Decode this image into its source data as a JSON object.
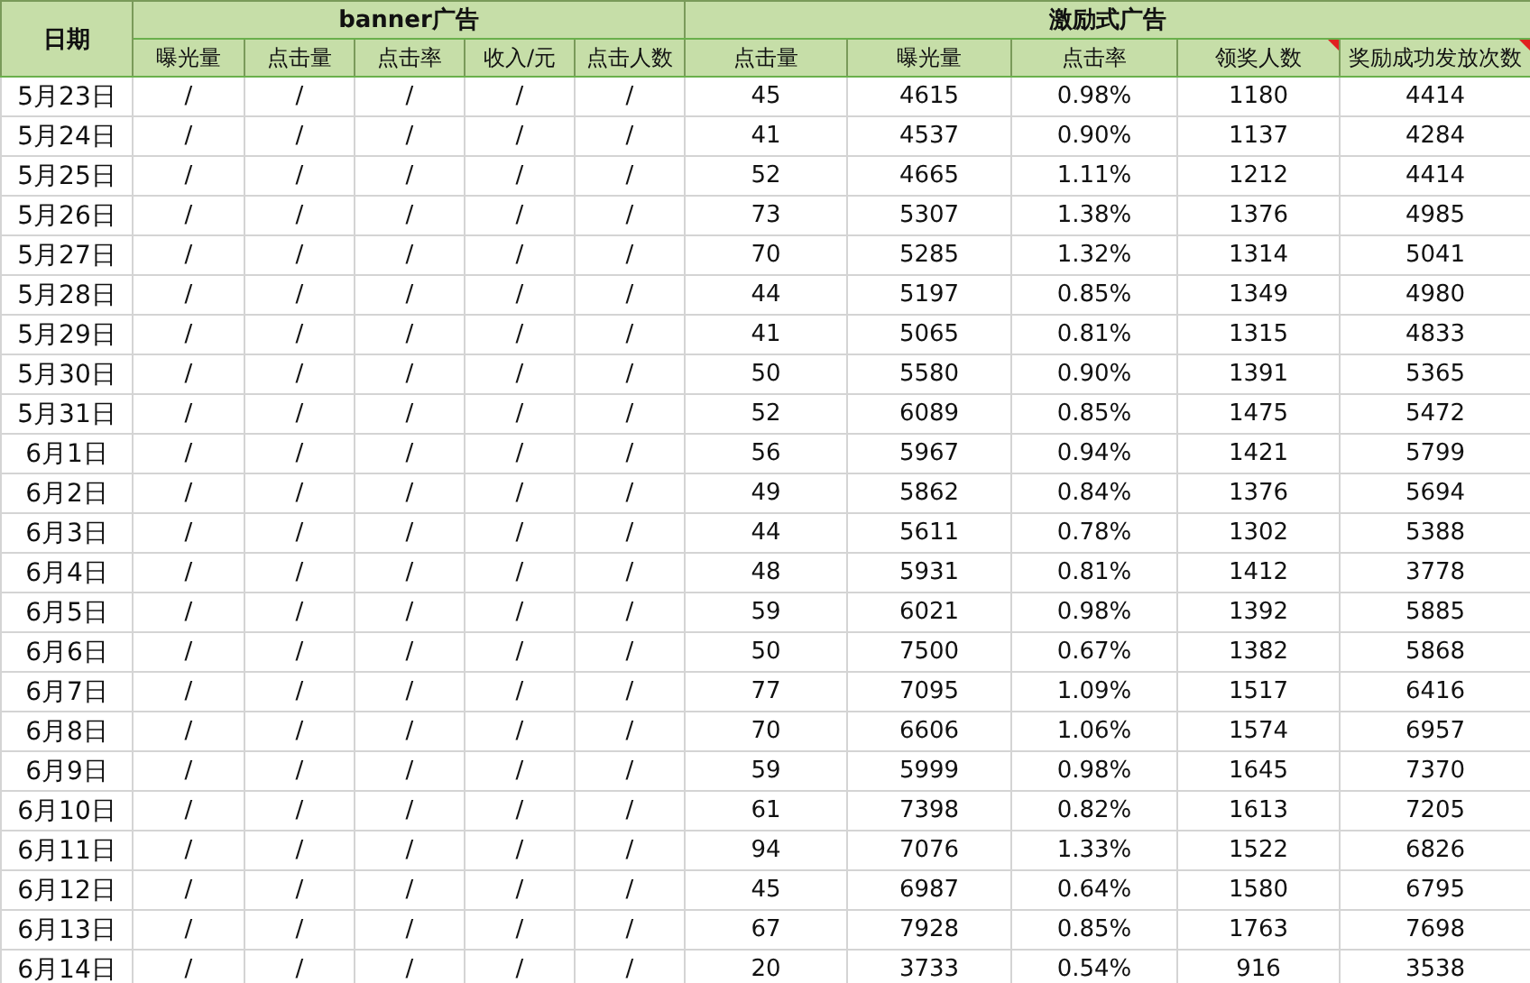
{
  "table": {
    "date_header": "日期",
    "groups": [
      {
        "title": "banner广告",
        "columns": [
          {
            "label": "曝光量",
            "has_comment": false
          },
          {
            "label": "点击量",
            "has_comment": false
          },
          {
            "label": "点击率",
            "has_comment": false
          },
          {
            "label": "收入/元",
            "has_comment": false
          },
          {
            "label": "点击人数",
            "has_comment": false
          }
        ]
      },
      {
        "title": "激励式广告",
        "columns": [
          {
            "label": "点击量",
            "has_comment": false
          },
          {
            "label": "曝光量",
            "has_comment": false
          },
          {
            "label": "点击率",
            "has_comment": false
          },
          {
            "label": "领奖人数",
            "has_comment": true
          },
          {
            "label": "奖励成功发放次数",
            "has_comment": true
          }
        ]
      }
    ],
    "rows": [
      {
        "date": "5月23日",
        "cells": [
          "/",
          "/",
          "/",
          "/",
          "/",
          "45",
          "4615",
          "0.98%",
          "1180",
          "4414"
        ]
      },
      {
        "date": "5月24日",
        "cells": [
          "/",
          "/",
          "/",
          "/",
          "/",
          "41",
          "4537",
          "0.90%",
          "1137",
          "4284"
        ]
      },
      {
        "date": "5月25日",
        "cells": [
          "/",
          "/",
          "/",
          "/",
          "/",
          "52",
          "4665",
          "1.11%",
          "1212",
          "4414"
        ]
      },
      {
        "date": "5月26日",
        "cells": [
          "/",
          "/",
          "/",
          "/",
          "/",
          "73",
          "5307",
          "1.38%",
          "1376",
          "4985"
        ]
      },
      {
        "date": "5月27日",
        "cells": [
          "/",
          "/",
          "/",
          "/",
          "/",
          "70",
          "5285",
          "1.32%",
          "1314",
          "5041"
        ]
      },
      {
        "date": "5月28日",
        "cells": [
          "/",
          "/",
          "/",
          "/",
          "/",
          "44",
          "5197",
          "0.85%",
          "1349",
          "4980"
        ]
      },
      {
        "date": "5月29日",
        "cells": [
          "/",
          "/",
          "/",
          "/",
          "/",
          "41",
          "5065",
          "0.81%",
          "1315",
          "4833"
        ]
      },
      {
        "date": "5月30日",
        "cells": [
          "/",
          "/",
          "/",
          "/",
          "/",
          "50",
          "5580",
          "0.90%",
          "1391",
          "5365"
        ]
      },
      {
        "date": "5月31日",
        "cells": [
          "/",
          "/",
          "/",
          "/",
          "/",
          "52",
          "6089",
          "0.85%",
          "1475",
          "5472"
        ]
      },
      {
        "date": "6月1日",
        "cells": [
          "/",
          "/",
          "/",
          "/",
          "/",
          "56",
          "5967",
          "0.94%",
          "1421",
          "5799"
        ]
      },
      {
        "date": "6月2日",
        "cells": [
          "/",
          "/",
          "/",
          "/",
          "/",
          "49",
          "5862",
          "0.84%",
          "1376",
          "5694"
        ]
      },
      {
        "date": "6月3日",
        "cells": [
          "/",
          "/",
          "/",
          "/",
          "/",
          "44",
          "5611",
          "0.78%",
          "1302",
          "5388"
        ]
      },
      {
        "date": "6月4日",
        "cells": [
          "/",
          "/",
          "/",
          "/",
          "/",
          "48",
          "5931",
          "0.81%",
          "1412",
          "3778"
        ]
      },
      {
        "date": "6月5日",
        "cells": [
          "/",
          "/",
          "/",
          "/",
          "/",
          "59",
          "6021",
          "0.98%",
          "1392",
          "5885"
        ]
      },
      {
        "date": "6月6日",
        "cells": [
          "/",
          "/",
          "/",
          "/",
          "/",
          "50",
          "7500",
          "0.67%",
          "1382",
          "5868"
        ]
      },
      {
        "date": "6月7日",
        "cells": [
          "/",
          "/",
          "/",
          "/",
          "/",
          "77",
          "7095",
          "1.09%",
          "1517",
          "6416"
        ]
      },
      {
        "date": "6月8日",
        "cells": [
          "/",
          "/",
          "/",
          "/",
          "/",
          "70",
          "6606",
          "1.06%",
          "1574",
          "6957"
        ]
      },
      {
        "date": "6月9日",
        "cells": [
          "/",
          "/",
          "/",
          "/",
          "/",
          "59",
          "5999",
          "0.98%",
          "1645",
          "7370"
        ]
      },
      {
        "date": "6月10日",
        "cells": [
          "/",
          "/",
          "/",
          "/",
          "/",
          "61",
          "7398",
          "0.82%",
          "1613",
          "7205"
        ]
      },
      {
        "date": "6月11日",
        "cells": [
          "/",
          "/",
          "/",
          "/",
          "/",
          "94",
          "7076",
          "1.33%",
          "1522",
          "6826"
        ]
      },
      {
        "date": "6月12日",
        "cells": [
          "/",
          "/",
          "/",
          "/",
          "/",
          "45",
          "6987",
          "0.64%",
          "1580",
          "6795"
        ]
      },
      {
        "date": "6月13日",
        "cells": [
          "/",
          "/",
          "/",
          "/",
          "/",
          "67",
          "7928",
          "0.85%",
          "1763",
          "7698"
        ]
      },
      {
        "date": "6月14日",
        "cells": [
          "/",
          "/",
          "/",
          "/",
          "/",
          "20",
          "3733",
          "0.54%",
          "916",
          "3538"
        ]
      }
    ]
  }
}
